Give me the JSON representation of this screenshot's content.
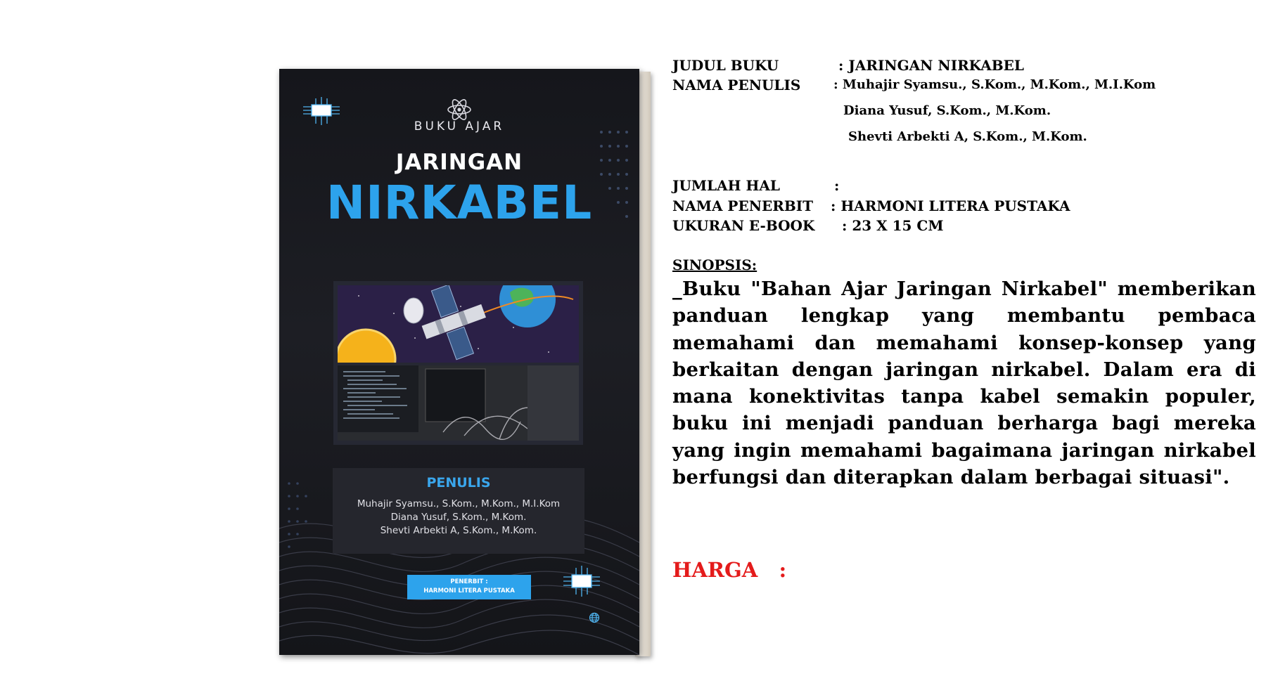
{
  "cover": {
    "kicker": "BUKU AJAR",
    "title_line1": "JARINGAN",
    "title_line2": "NIRKABEL",
    "authors_label": "PENULIS",
    "authors": [
      "Muhajir Syamsu., S.Kom., M.Kom., M.I.Kom",
      "Diana Yusuf, S.Kom., M.Kom.",
      "Shevti Arbekti A, S.Kom., M.Kom."
    ],
    "publisher_label": "PENERBIT :",
    "publisher": "HARMONI LITERA PUSTAKA",
    "colors": {
      "background": "#17181d",
      "accent": "#2da3ec"
    }
  },
  "info": {
    "judul_label": "JUDUL BUKU",
    "judul_value": ": JARINGAN NIRKABEL",
    "penulis_label": "NAMA PENULIS",
    "penulis_1": ": Muhajir Syamsu., S.Kom., M.Kom., M.I.Kom",
    "penulis_2": "Diana Yusuf, S.Kom., M.Kom.",
    "penulis_3": "Shevti Arbekti A, S.Kom., M.Kom.",
    "jumlah_label": "JUMLAH HAL",
    "jumlah_value": ":",
    "penerbit_label": "NAMA PENERBIT",
    "penerbit_value": ": HARMONI LITERA PUSTAKA",
    "ukuran_label": "UKURAN E-BOOK",
    "ukuran_value": ": 23 X 15 CM"
  },
  "synopsis": {
    "heading": "SINOPSIS:",
    "text": "_Buku \"Bahan Ajar Jaringan Nirkabel\" memberikan panduan lengkap yang membantu pembaca memahami dan memahami konsep-konsep yang berkaitan dengan jaringan nirkabel. Dalam era di mana konektivitas tanpa kabel semakin populer, buku ini menjadi panduan berharga bagi mereka yang ingin memahami bagaimana jaringan nirkabel berfungsi dan diterapkan dalam berbagai situasi\"."
  },
  "price": {
    "label": "HARGA   :",
    "color": "#e41b1b"
  }
}
